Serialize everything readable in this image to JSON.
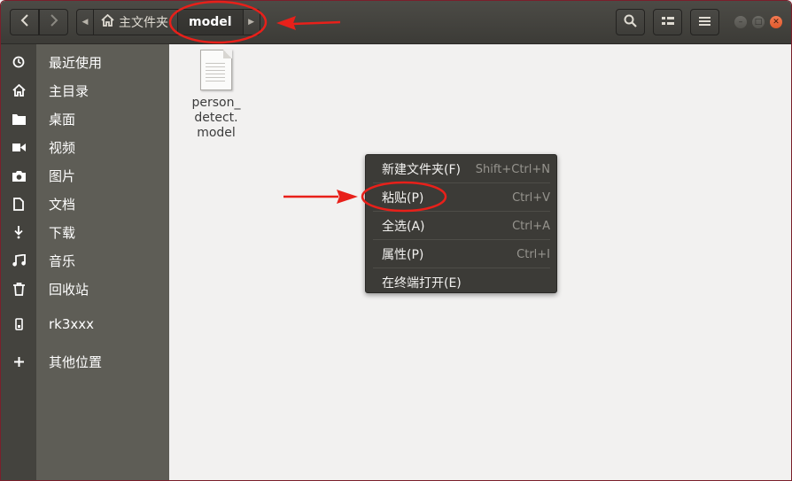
{
  "header": {
    "back_icon": "chevron-left-icon",
    "forward_icon": "chevron-right-icon",
    "path": {
      "home_label": "主文件夹",
      "current_label": "model"
    },
    "search_icon": "search-icon",
    "view_icon": "list-view-icon",
    "menu_icon": "hamburger-menu-icon"
  },
  "sidebar": {
    "items": [
      {
        "label": "最近使用",
        "icon": "clock-icon"
      },
      {
        "label": "主目录",
        "icon": "home-icon"
      },
      {
        "label": "桌面",
        "icon": "folder-icon"
      },
      {
        "label": "视频",
        "icon": "video-icon"
      },
      {
        "label": "图片",
        "icon": "camera-icon"
      },
      {
        "label": "文档",
        "icon": "document-icon"
      },
      {
        "label": "下载",
        "icon": "download-icon"
      },
      {
        "label": "音乐",
        "icon": "music-icon"
      },
      {
        "label": "回收站",
        "icon": "trash-icon"
      },
      {
        "label": "rk3xxx",
        "icon": "phone-device-icon"
      },
      {
        "label": "其他位置",
        "icon": "plus-icon"
      }
    ]
  },
  "files": [
    {
      "name": "person_\ndetect.\nmodel",
      "icon": "text-file-icon"
    }
  ],
  "context_menu": {
    "items": [
      {
        "label": "新建文件夹(F)",
        "accel": "Shift+Ctrl+N"
      },
      {
        "label": "粘贴(P)",
        "accel": "Ctrl+V"
      },
      {
        "label": "全选(A)",
        "accel": "Ctrl+A"
      },
      {
        "label": "属性(P)",
        "accel": "Ctrl+I"
      },
      {
        "label": "在终端打开(E)",
        "accel": ""
      }
    ]
  },
  "colors": {
    "annotation_red": "#e8201a",
    "titlebar": "#3c3b37",
    "sidebar": "#5e5d56",
    "close_button": "#e95420"
  }
}
